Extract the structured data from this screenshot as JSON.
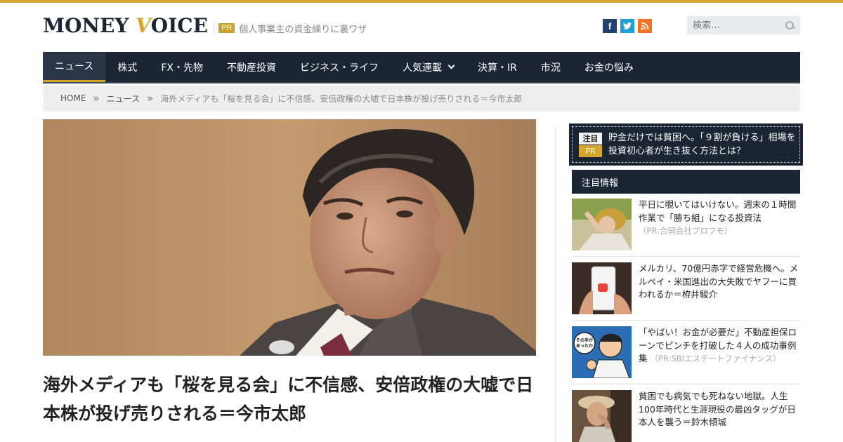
{
  "brand": {
    "logo_main": "MONEY ",
    "logo_accent": "V",
    "logo_rest": "OICE"
  },
  "header": {
    "pr_badge": "PR",
    "pr_text": "個人事業主の資金繰りに裏ワザ",
    "social": [
      "f",
      "t",
      "rss"
    ],
    "search_placeholder": "検索…"
  },
  "nav": {
    "items": [
      {
        "label": "ニュース",
        "active": true
      },
      {
        "label": "株式"
      },
      {
        "label": "FX・先物"
      },
      {
        "label": "不動産投資"
      },
      {
        "label": "ビジネス・ライフ"
      },
      {
        "label": "人気連載",
        "has_dropdown": true
      },
      {
        "label": "決算・IR"
      },
      {
        "label": "市況"
      },
      {
        "label": "お金の悩み"
      }
    ]
  },
  "breadcrumb": {
    "home": "HOME",
    "sep": "»",
    "category": "ニュース",
    "current": "海外メディアも「桜を見る会」に不信感、安倍政権の大嘘で日本株が投げ売りされる＝今市太郎"
  },
  "article": {
    "title": "海外メディアも「桜を見る会」に不信感、安倍政権の大嘘で日本株が投げ売りされる＝今市太郎"
  },
  "sidebar": {
    "notice": {
      "badge_top": "注目",
      "badge_bottom": "PR",
      "text": "貯金だけでは貧困へ。「９割が負ける」相場を投資初心者が生き抜く方法とは？"
    },
    "section_title": "注目情報",
    "items": [
      {
        "title": "平日に覗いてはいけない。週末の１時間作業で「勝ち組」になる投資法",
        "source": "（PR:合同会社ブロフモ）"
      },
      {
        "title": "メルカリ、70億円赤字で経営危機へ。メルペイ・米国進出の大失敗でヤフーに買われるか＝栫井駿介",
        "source": ""
      },
      {
        "title": "「やばい！お金が必要だ」不動産担保ローンでピンチを打破した４人の成功事例集",
        "source": "（PR:SBIエステートファイナンス）"
      },
      {
        "title": "貧困でも病気でも死ねない地獄。人生100年時代と生涯現役の最凶タッグが日本人を襲う＝鈴木傾城",
        "source": ""
      }
    ],
    "thumb_texts": {
      "manga_bubble": "その手があったか！"
    }
  }
}
